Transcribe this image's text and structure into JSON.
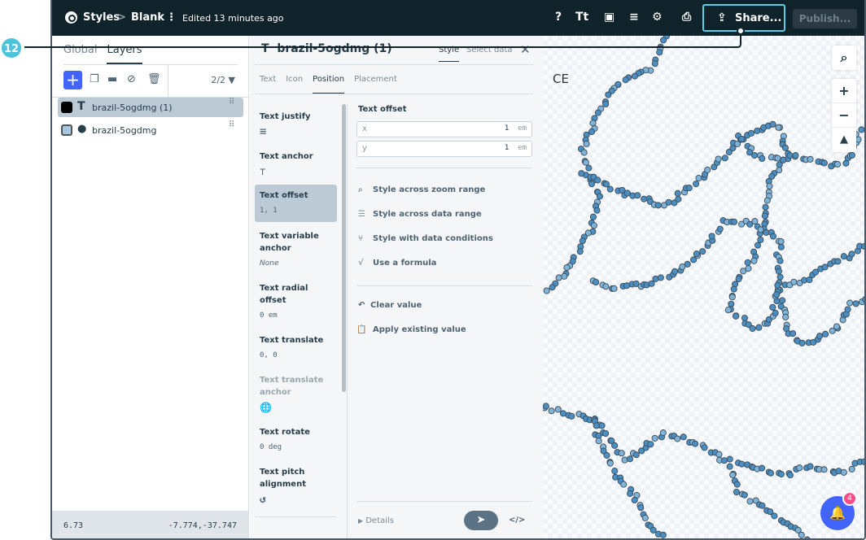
{
  "callout": {
    "number": "12"
  },
  "topbar": {
    "styles": "Styles",
    "separator": ">",
    "style_name": "Blank",
    "edited": "Edited 13 minutes ago",
    "share_label": "Share...",
    "publish_label": "Publish..."
  },
  "left": {
    "tabs": [
      "Global",
      "Layers"
    ],
    "count": "2/2",
    "layers": [
      {
        "name": "brazil-5ogdmg (1)",
        "type": "T",
        "swatch": "#000000"
      },
      {
        "name": "brazil-5ogdmg",
        "type": "●",
        "swatch": "#a7c8e0"
      }
    ],
    "zoom": "6.73",
    "coords": "-7.774,-37.747"
  },
  "mid": {
    "title": "brazil-5ogdmg (1)",
    "style_tab": "Style",
    "select_data_tab": "Select data",
    "prop_tabs": [
      "Text",
      "Icon",
      "Position",
      "Placement"
    ],
    "props": [
      {
        "label": "Text justify",
        "value": "≡"
      },
      {
        "label": "Text anchor",
        "value": "⊤"
      },
      {
        "label": "Text offset",
        "value": "1, 1"
      },
      {
        "label": "Text variable anchor",
        "value": "None"
      },
      {
        "label": "Text radial offset",
        "value": "0 em"
      },
      {
        "label": "Text translate",
        "value": "0, 0"
      },
      {
        "label": "Text translate anchor",
        "value": "🌐"
      },
      {
        "label": "Text rotate",
        "value": "0 deg"
      },
      {
        "label": "Text pitch alignment",
        "value": "↺"
      }
    ],
    "editor": {
      "heading": "Text offset",
      "x_label": "x",
      "x_value": "1",
      "y_label": "y",
      "y_value": "1",
      "unit": "em",
      "actions": [
        "Style across zoom range",
        "Style across data range",
        "Style with data conditions",
        "Use a formula"
      ],
      "clear": "Clear value",
      "apply": "Apply existing value",
      "details": "Details",
      "code": "</>"
    }
  },
  "map": {
    "label": "CE",
    "notifications": "4",
    "dot_color": "#4b8fc2"
  }
}
